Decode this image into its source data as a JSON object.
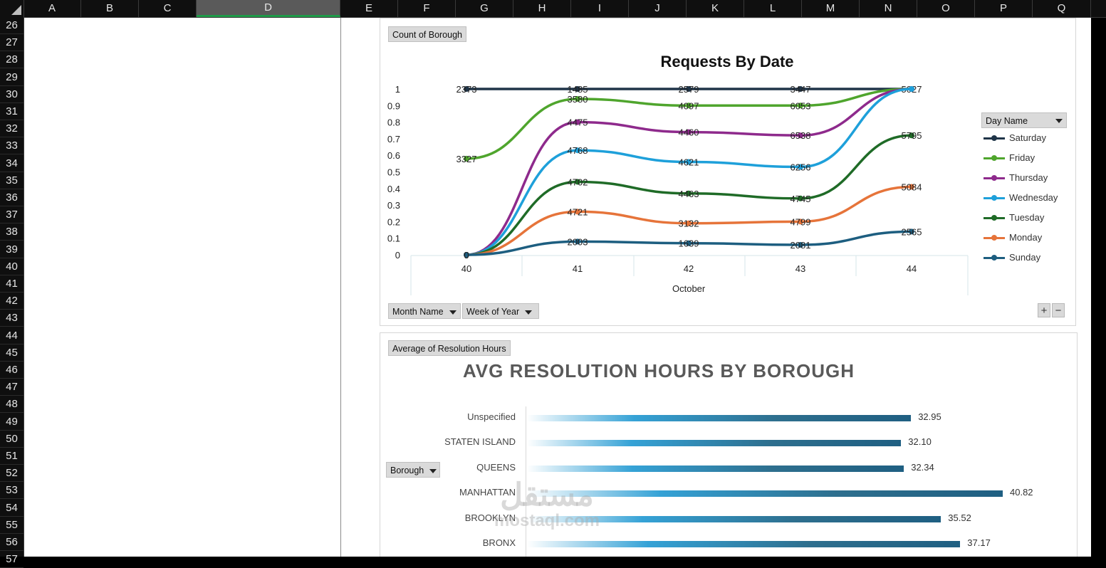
{
  "columns": [
    "A",
    "B",
    "C",
    "D",
    "E",
    "F",
    "G",
    "H",
    "I",
    "J",
    "K",
    "L",
    "M",
    "N",
    "O",
    "P",
    "Q"
  ],
  "selected_column": "D",
  "rows": [
    "26",
    "27",
    "28",
    "29",
    "30",
    "31",
    "32",
    "33",
    "34",
    "35",
    "36",
    "37",
    "38",
    "39",
    "40",
    "41",
    "42",
    "43",
    "44",
    "45",
    "46",
    "47",
    "48",
    "49",
    "50",
    "51",
    "52",
    "53",
    "54",
    "55",
    "56",
    "57"
  ],
  "chart1": {
    "value_field": "Count of Borough",
    "title": "Requests By Date",
    "legend_field": "Day Name",
    "axis_fields": [
      "Month Name",
      "Week of Year"
    ],
    "plus_label": "+",
    "minus_label": "−"
  },
  "chart2": {
    "value_field": "Average of Resolution Hours",
    "title": "AVG RESOLUTION HOURS BY BOROUGH",
    "axis_field": "Borough"
  },
  "watermark": {
    "arabic": "مستقل",
    "latin": "mostaql.com"
  },
  "colors": {
    "Saturday": "#1f3448",
    "Friday": "#4fa52d",
    "Thursday": "#8e2a8c",
    "Wednesday": "#1ea0da",
    "Tuesday": "#1f6b27",
    "Monday": "#e6743a",
    "Sunday": "#1d5e80",
    "selected_col_underline": "#1e9a48"
  },
  "chart_data": [
    {
      "type": "line",
      "title": "Requests By Date",
      "x": [
        "40",
        "41",
        "42",
        "43",
        "44"
      ],
      "x_group_label": "October",
      "ylim": [
        0,
        1
      ],
      "yticks": [
        "0",
        "0.1",
        "0.2",
        "0.3",
        "0.4",
        "0.5",
        "0.6",
        "0.7",
        "0.8",
        "0.9",
        "1"
      ],
      "legend_title": "Day Name",
      "legend_position": "right",
      "series": [
        {
          "name": "Saturday",
          "values": [
            1,
            1,
            1,
            1,
            1
          ],
          "labels": [
            "2373",
            "1485",
            "2579",
            "3447",
            "5027"
          ]
        },
        {
          "name": "Friday",
          "values": [
            0.58,
            0.94,
            0.9,
            0.9,
            1
          ],
          "labels": [
            "3327",
            "3580",
            "4097",
            "6053",
            ""
          ]
        },
        {
          "name": "Thursday",
          "values": [
            0,
            0.8,
            0.74,
            0.72,
            1
          ],
          "labels": [
            "0",
            "4475",
            "4460",
            "6538",
            ""
          ]
        },
        {
          "name": "Wednesday",
          "values": [
            0,
            0.63,
            0.56,
            0.53,
            1
          ],
          "labels": [
            "0",
            "4768",
            "4621",
            "6256",
            ""
          ]
        },
        {
          "name": "Tuesday",
          "values": [
            0,
            0.44,
            0.37,
            0.34,
            0.72
          ],
          "labels": [
            "0",
            "4702",
            "4463",
            "4745",
            "5795"
          ]
        },
        {
          "name": "Monday",
          "values": [
            0,
            0.26,
            0.19,
            0.2,
            0.41
          ],
          "labels": [
            "0",
            "4721",
            "3132",
            "4799",
            "5084"
          ]
        },
        {
          "name": "Sunday",
          "values": [
            0,
            0.08,
            0.07,
            0.06,
            0.14
          ],
          "labels": [
            "0",
            "2003",
            "1639",
            "2081",
            "2565"
          ]
        }
      ]
    },
    {
      "type": "bar",
      "orientation": "horizontal",
      "title": "AVG RESOLUTION HOURS BY BOROUGH",
      "categories": [
        "Unspecified",
        "STATEN ISLAND",
        "QUEENS",
        "MANHATTAN",
        "BROOKLYN",
        "BRONX"
      ],
      "values": [
        32.95,
        32.1,
        32.34,
        40.82,
        35.52,
        37.17
      ],
      "value_labels": [
        "32.95",
        "32.10",
        "32.34",
        "40.82",
        "35.52",
        "37.17"
      ]
    }
  ]
}
